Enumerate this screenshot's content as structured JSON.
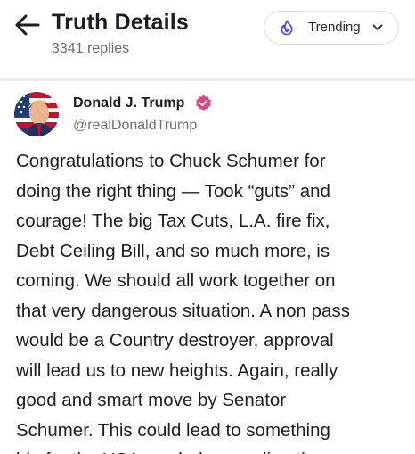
{
  "header": {
    "title": "Truth Details",
    "reply_count": "3341 replies",
    "trending_label": "Trending"
  },
  "author": {
    "name": "Donald J. Trump",
    "handle": "@realDonaldTrump",
    "verified_color": "#e0457b"
  },
  "post": {
    "lines": [
      "Congratulations to Chuck Schumer for",
      "doing the right thing — Took “guts” and",
      "courage! The big Tax Cuts, L.A. fire fix,",
      "Debt Ceiling Bill, and so much more, is",
      "coming. We should all work together on",
      "that very dangerous situation. A non pass",
      "would be a Country destroyer, approval",
      "will lead us to new heights. Again, really",
      "good and smart move by Senator",
      "Schumer. This could lead to something",
      "big for the USA, a whole new direction"
    ]
  },
  "colors": {
    "accent": "#5a4ee6",
    "text": "#1e1e24",
    "muted": "#6b6b78"
  },
  "icons": {
    "back": "arrow-left",
    "trending": "flame",
    "dropdown": "chevron-down",
    "verified": "check-badge"
  }
}
